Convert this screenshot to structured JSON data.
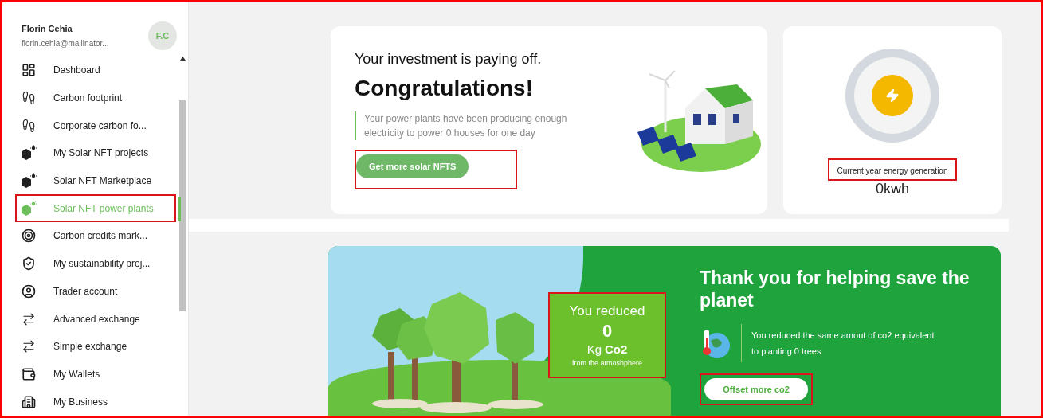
{
  "user": {
    "name": "Florin Cehia",
    "email": "florin.cehia@mailinator...",
    "initials": "F.C"
  },
  "sidebar": {
    "items": [
      {
        "label": "Dashboard",
        "kind": "dashboard",
        "selected": false,
        "highlighted": false
      },
      {
        "label": "Carbon footprint",
        "kind": "footprint",
        "selected": false,
        "highlighted": false
      },
      {
        "label": "Corporate carbon fo...",
        "kind": "footprint",
        "selected": false,
        "highlighted": false
      },
      {
        "label": "My Solar NFT projects",
        "kind": "nft",
        "selected": false,
        "highlighted": false
      },
      {
        "label": "Solar NFT Marketplace",
        "kind": "nft",
        "selected": false,
        "highlighted": false
      },
      {
        "label": "Solar NFT power plants",
        "kind": "nft",
        "selected": true,
        "highlighted": true
      },
      {
        "label": "Carbon credits mark...",
        "kind": "target",
        "selected": false,
        "highlighted": false
      },
      {
        "label": "My sustainability proj...",
        "kind": "shield",
        "selected": false,
        "highlighted": false
      },
      {
        "label": "Trader account",
        "kind": "user",
        "selected": false,
        "highlighted": false
      },
      {
        "label": "Advanced exchange",
        "kind": "exchange",
        "selected": false,
        "highlighted": false
      },
      {
        "label": "Simple exchange",
        "kind": "exchange",
        "selected": false,
        "highlighted": false
      },
      {
        "label": "My Wallets",
        "kind": "wallet",
        "selected": false,
        "highlighted": false
      },
      {
        "label": "My Business",
        "kind": "business",
        "selected": false,
        "highlighted": false
      }
    ]
  },
  "investment_card": {
    "subtitle": "Your investment is paying off.",
    "title": "Congratulations!",
    "text": "Your power plants have been producing enough electricity to power 0 houses for one day",
    "button": {
      "label": "Get more solar NFTS",
      "highlighted": true
    }
  },
  "energy_card": {
    "label": "Current year energy generation",
    "label_highlighted": true,
    "value": "0kwh"
  },
  "banner": {
    "reduced": {
      "title": "You reduced",
      "value": "0",
      "unit_prefix": "Kg",
      "unit": "Co2",
      "note": "from the atmoshphere",
      "highlighted": true
    },
    "title": "Thank you for helping save the planet",
    "text": "You reduced the same amout of co2 equivalent to planting 0 trees",
    "button": {
      "label": "Offset more co2",
      "highlighted": true
    }
  }
}
